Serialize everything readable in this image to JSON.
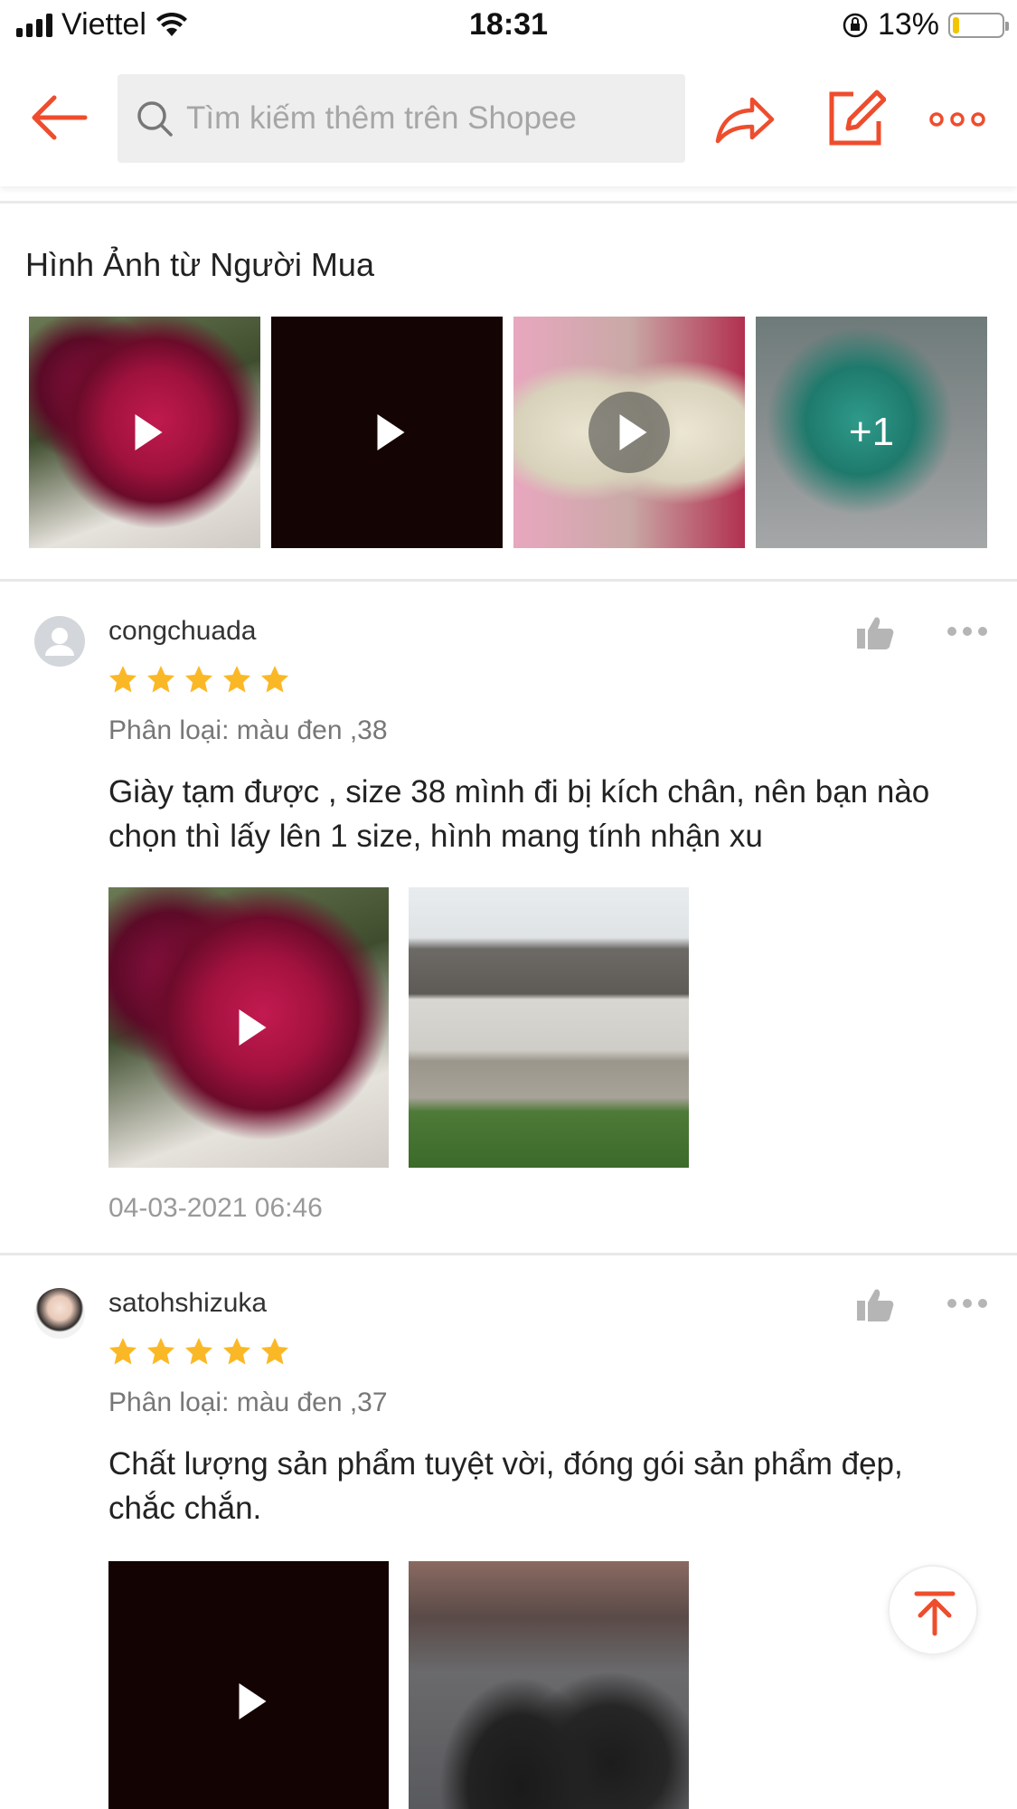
{
  "status_bar": {
    "carrier": "Viettel",
    "time": "18:31",
    "battery_percent": "13%",
    "battery_level": 0.13
  },
  "nav": {
    "search_placeholder": "Tìm kiếm thêm trên Shopee",
    "icons": [
      "back-arrow-icon",
      "search-icon",
      "share-icon",
      "edit-icon",
      "more-dots-icon"
    ],
    "accent_color": "#ee4d2d"
  },
  "buyer_images": {
    "title": "Hình Ảnh từ Người Mua",
    "more_count": "+1"
  },
  "reviews": [
    {
      "username": "congchuada",
      "rating": 5,
      "variant": "Phân loại: màu đen ,38",
      "comment": "Giày tạm được , size 38 mình đi bị kích chân, nên bạn nào chọn thì lấy lên 1 size, hình mang tính nhận xu",
      "timestamp": "04-03-2021 06:46"
    },
    {
      "username": "satohshizuka",
      "rating": 5,
      "variant": "Phân loại: màu đen ,37",
      "comment": "Chất lượng sản phẩm tuyệt vời, đóng gói sản phẩm đẹp, chắc chắn."
    }
  ],
  "colors": {
    "star": "#fbb826",
    "accent": "#ee4d2d"
  }
}
